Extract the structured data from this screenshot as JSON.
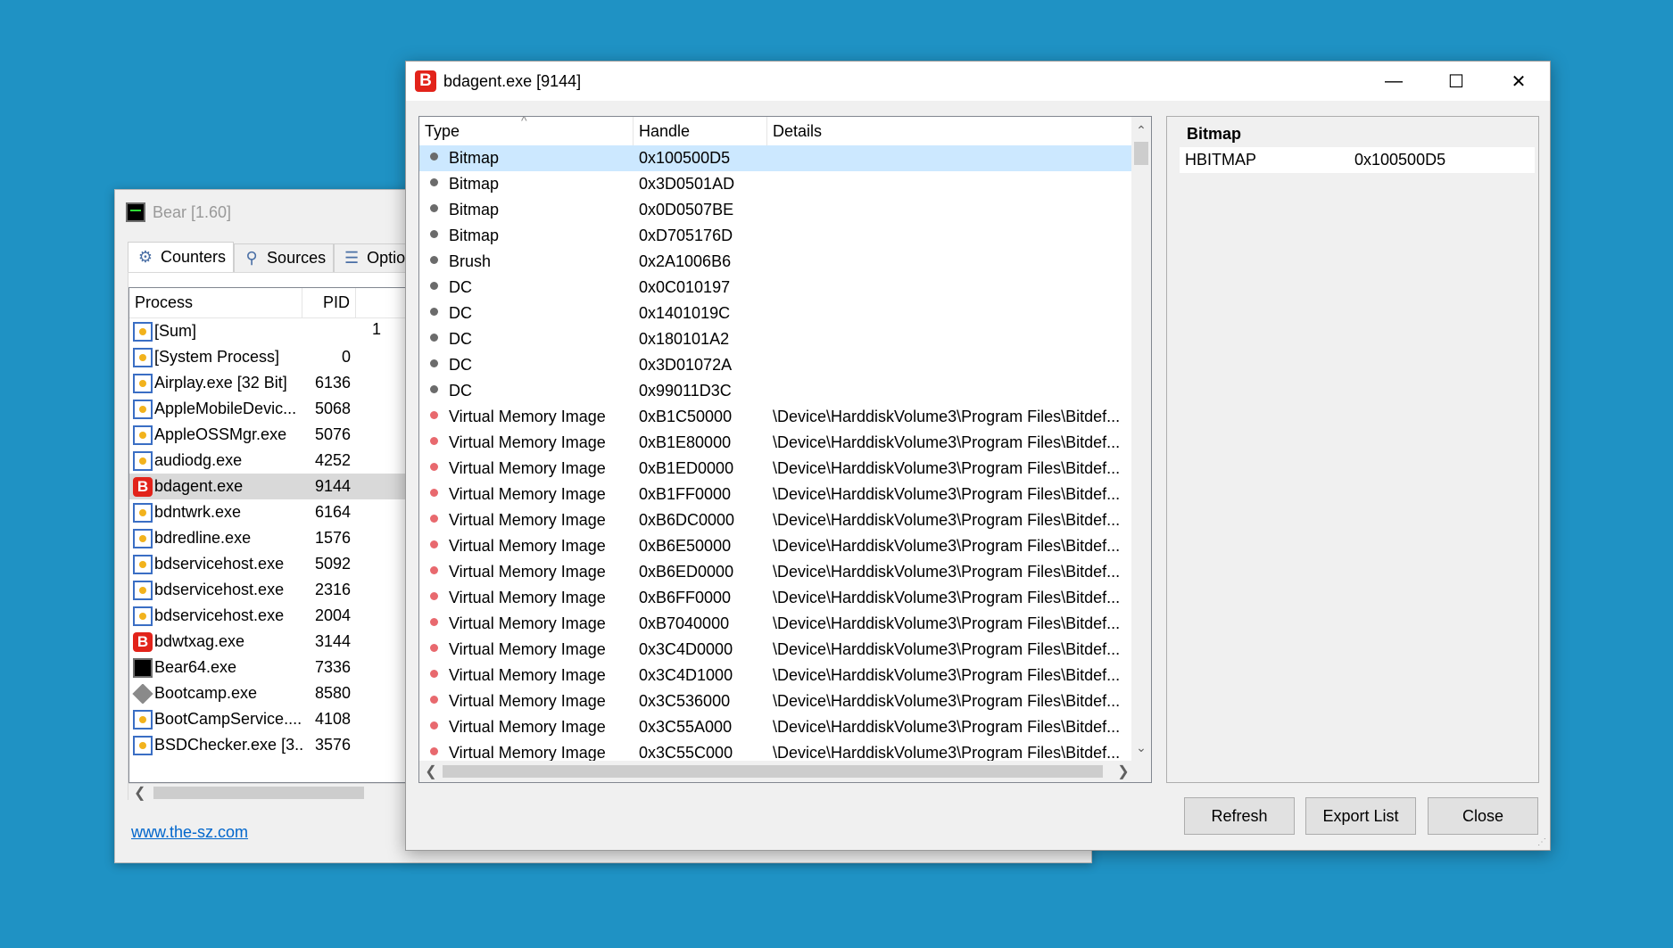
{
  "bear_window": {
    "title": "Bear [1.60]",
    "tabs": [
      {
        "label": "Counters",
        "icon": "gear-icon"
      },
      {
        "label": "Sources",
        "icon": "magnifier-icon"
      },
      {
        "label": "Option",
        "icon": "options-icon"
      }
    ],
    "columns": [
      "Process",
      "PID"
    ],
    "partial_value": "1",
    "rows": [
      {
        "name": "[Sum]",
        "pid": "",
        "icon": "win"
      },
      {
        "name": "[System Process]",
        "pid": "0",
        "icon": "win"
      },
      {
        "name": "Airplay.exe [32 Bit]",
        "pid": "6136",
        "icon": "win"
      },
      {
        "name": "AppleMobileDevic...",
        "pid": "5068",
        "icon": "win"
      },
      {
        "name": "AppleOSSMgr.exe",
        "pid": "5076",
        "icon": "win"
      },
      {
        "name": "audiodg.exe",
        "pid": "4252",
        "icon": "win"
      },
      {
        "name": "bdagent.exe",
        "pid": "9144",
        "icon": "b",
        "selected": true
      },
      {
        "name": "bdntwrk.exe",
        "pid": "6164",
        "icon": "win"
      },
      {
        "name": "bdredline.exe",
        "pid": "1576",
        "icon": "win"
      },
      {
        "name": "bdservicehost.exe",
        "pid": "5092",
        "icon": "win"
      },
      {
        "name": "bdservicehost.exe",
        "pid": "2316",
        "icon": "win"
      },
      {
        "name": "bdservicehost.exe",
        "pid": "2004",
        "icon": "win"
      },
      {
        "name": "bdwtxag.exe",
        "pid": "3144",
        "icon": "b"
      },
      {
        "name": "Bear64.exe",
        "pid": "7336",
        "icon": "bear"
      },
      {
        "name": "Bootcamp.exe",
        "pid": "8580",
        "icon": "boot"
      },
      {
        "name": "BootCampService....",
        "pid": "4108",
        "icon": "win"
      },
      {
        "name": "BSDChecker.exe [3...",
        "pid": "3576",
        "icon": "win"
      }
    ],
    "link": "www.the-sz.com"
  },
  "dialog": {
    "title": "bdagent.exe [9144]",
    "app_icon_letter": "B",
    "window_controls": {
      "minimize": "—",
      "maximize": "☐",
      "close": "✕"
    },
    "columns": [
      "Type",
      "Handle",
      "Details"
    ],
    "sort_indicator": "^",
    "rows": [
      {
        "type": "Bitmap",
        "handle": "0x100500D5",
        "details": "",
        "dot": "gray",
        "selected": true
      },
      {
        "type": "Bitmap",
        "handle": "0x3D0501AD",
        "details": "",
        "dot": "gray"
      },
      {
        "type": "Bitmap",
        "handle": "0x0D0507BE",
        "details": "",
        "dot": "gray"
      },
      {
        "type": "Bitmap",
        "handle": "0xD705176D",
        "details": "",
        "dot": "gray"
      },
      {
        "type": "Brush",
        "handle": "0x2A1006B6",
        "details": "",
        "dot": "gray"
      },
      {
        "type": "DC",
        "handle": "0x0C010197",
        "details": "",
        "dot": "gray"
      },
      {
        "type": "DC",
        "handle": "0x1401019C",
        "details": "",
        "dot": "gray"
      },
      {
        "type": "DC",
        "handle": "0x180101A2",
        "details": "",
        "dot": "gray"
      },
      {
        "type": "DC",
        "handle": "0x3D01072A",
        "details": "",
        "dot": "gray"
      },
      {
        "type": "DC",
        "handle": "0x99011D3C",
        "details": "",
        "dot": "gray"
      },
      {
        "type": "Virtual Memory Image",
        "handle": "0xB1C50000",
        "details": "\\Device\\HarddiskVolume3\\Program Files\\Bitdef...",
        "dot": "red"
      },
      {
        "type": "Virtual Memory Image",
        "handle": "0xB1E80000",
        "details": "\\Device\\HarddiskVolume3\\Program Files\\Bitdef...",
        "dot": "red"
      },
      {
        "type": "Virtual Memory Image",
        "handle": "0xB1ED0000",
        "details": "\\Device\\HarddiskVolume3\\Program Files\\Bitdef...",
        "dot": "red"
      },
      {
        "type": "Virtual Memory Image",
        "handle": "0xB1FF0000",
        "details": "\\Device\\HarddiskVolume3\\Program Files\\Bitdef...",
        "dot": "red"
      },
      {
        "type": "Virtual Memory Image",
        "handle": "0xB6DC0000",
        "details": "\\Device\\HarddiskVolume3\\Program Files\\Bitdef...",
        "dot": "red"
      },
      {
        "type": "Virtual Memory Image",
        "handle": "0xB6E50000",
        "details": "\\Device\\HarddiskVolume3\\Program Files\\Bitdef...",
        "dot": "red"
      },
      {
        "type": "Virtual Memory Image",
        "handle": "0xB6ED0000",
        "details": "\\Device\\HarddiskVolume3\\Program Files\\Bitdef...",
        "dot": "red"
      },
      {
        "type": "Virtual Memory Image",
        "handle": "0xB6FF0000",
        "details": "\\Device\\HarddiskVolume3\\Program Files\\Bitdef...",
        "dot": "red"
      },
      {
        "type": "Virtual Memory Image",
        "handle": "0xB7040000",
        "details": "\\Device\\HarddiskVolume3\\Program Files\\Bitdef...",
        "dot": "red"
      },
      {
        "type": "Virtual Memory Image",
        "handle": "0x3C4D0000",
        "details": "\\Device\\HarddiskVolume3\\Program Files\\Bitdef...",
        "dot": "red"
      },
      {
        "type": "Virtual Memory Image",
        "handle": "0x3C4D1000",
        "details": "\\Device\\HarddiskVolume3\\Program Files\\Bitdef...",
        "dot": "red"
      },
      {
        "type": "Virtual Memory Image",
        "handle": "0x3C536000",
        "details": "\\Device\\HarddiskVolume3\\Program Files\\Bitdef...",
        "dot": "red"
      },
      {
        "type": "Virtual Memory Image",
        "handle": "0x3C55A000",
        "details": "\\Device\\HarddiskVolume3\\Program Files\\Bitdef...",
        "dot": "red"
      },
      {
        "type": "Virtual Memory Image",
        "handle": "0x3C55C000",
        "details": "\\Device\\HarddiskVolume3\\Program Files\\Bitdef...",
        "dot": "red"
      }
    ],
    "properties": {
      "title": "Bitmap",
      "rows": [
        {
          "key": "HBITMAP",
          "value": "0x100500D5"
        }
      ]
    },
    "buttons": {
      "refresh": "Refresh",
      "export": "Export List",
      "close": "Close"
    }
  },
  "colors": {
    "desktop": "#1f92c4",
    "selection": "#cce8ff",
    "dot_gray": "#6b6b6b",
    "dot_red": "#e8696e",
    "brand_red": "#e2231a",
    "link": "#0066cc"
  }
}
